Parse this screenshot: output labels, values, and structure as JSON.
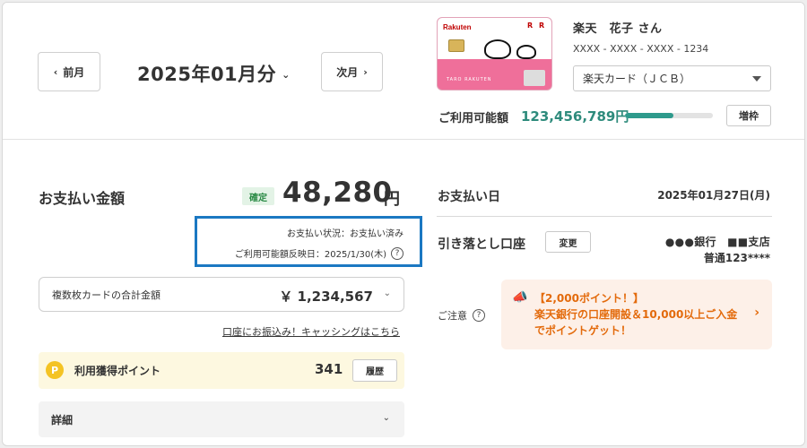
{
  "header": {
    "prev_label": "前月",
    "next_label": "次月",
    "month_title": "2025年01月分",
    "card": {
      "holder_name": "楽天　花子 さん",
      "number": "XXXX - XXXX - XXXX - 1234",
      "selected": "楽天カード（ＪＣＢ）",
      "brand": "Rakuten",
      "printed_name": "TARO RAKUTEN"
    },
    "available": {
      "label": "ご利用可能額",
      "value": "123,456,789円",
      "fill_fraction": 0.55,
      "increase_label": "増枠"
    }
  },
  "payment": {
    "title": "お支払い金額",
    "badge": "確定",
    "amount": "48,280",
    "unit": "円",
    "status_line": "お支払い状況：お支払い済み",
    "reflect_line": "ご利用可能額反映日：2025/1/30(木)",
    "multi_card_label": "複数枚カードの合計金額",
    "multi_card_value": "￥ 1,234,567",
    "transfer_link": "口座にお振込み！キャッシングはこちら",
    "points_label": "利用獲得ポイント",
    "points_value": "341",
    "history_label": "履歴",
    "detail_label": "詳細"
  },
  "right": {
    "pay_date_label": "お支払い日",
    "pay_date_value": "2025年01月27日(月)",
    "withdrawal_label": "引き落とし口座",
    "change_label": "変更",
    "bank_line1": "●●●銀行　■■支店",
    "bank_line2": "普通123****",
    "notice_label": "ご注意",
    "promo_line1": "【2,000ポイント！】",
    "promo_line2": "楽天銀行の口座開設＆10,000以上ご入金",
    "promo_line3": "でポイントゲット！"
  },
  "colors": {
    "accent_green": "#2e8b7c",
    "highlight_border": "#1b78c2",
    "promo_orange": "#e36a0b",
    "card_pink": "#ef6f9a"
  },
  "icons": [
    "chevron-left-icon",
    "chevron-right-icon",
    "caret-down-icon",
    "help-icon",
    "point-coin-icon",
    "megaphone-icon",
    "chevron-down-icon"
  ]
}
